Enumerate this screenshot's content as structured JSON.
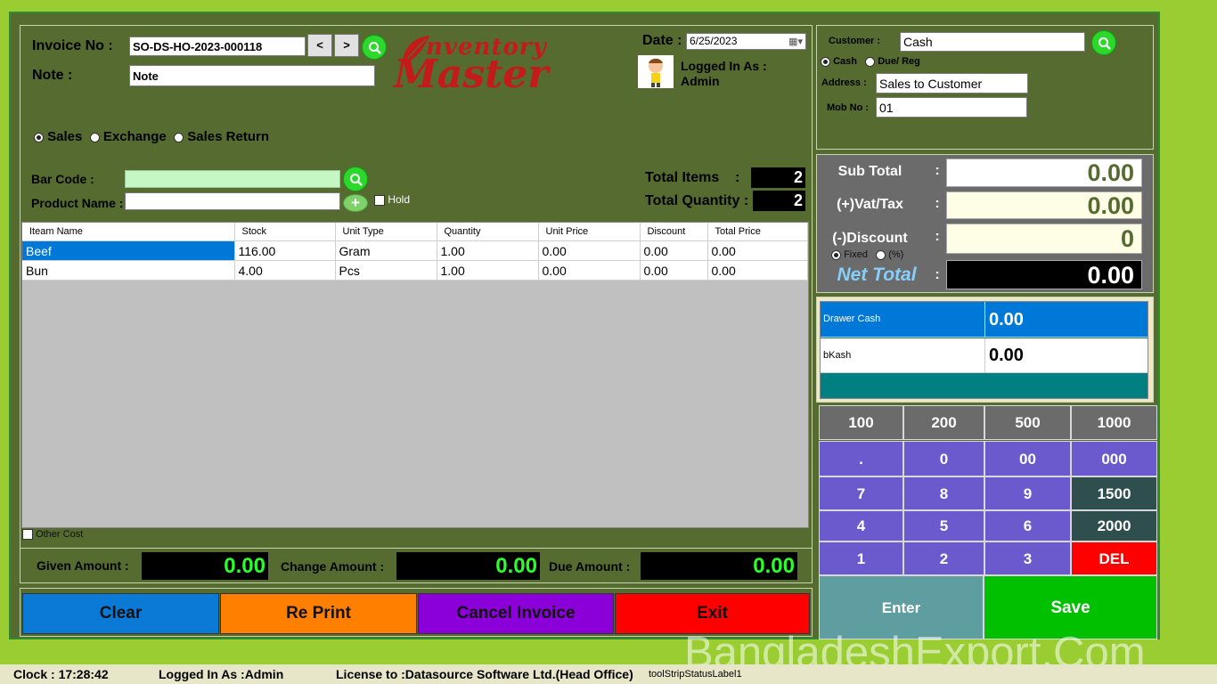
{
  "invoice": {
    "invoice_no_label": "Invoice No :",
    "invoice_no_value": "SO-DS-HO-2023-000118",
    "prev_label": "<",
    "next_label": ">",
    "note_label": "Note :",
    "note_value": "Note"
  },
  "logo": {
    "line1": "nventory",
    "line2": "Master"
  },
  "date": {
    "label": "Date :",
    "value": "6/25/2023"
  },
  "login": {
    "line1": "Logged In As :",
    "line2": "Admin"
  },
  "customer": {
    "label": "Customer :",
    "value": "Cash",
    "radio_cash": "Cash",
    "radio_due": "Due/ Reg",
    "address_label": "Address :",
    "address_value": "Sales to Customer",
    "mob_label": "Mob No :",
    "mob_value": "01"
  },
  "mode": {
    "sales": "Sales",
    "exchange": "Exchange",
    "sales_return": "Sales Return",
    "selected": "sales"
  },
  "entry": {
    "barcode_label": "Bar Code :",
    "product_label": "Product Name :",
    "hold_label": "Hold",
    "total_items_label": "Total Items    :",
    "total_items_value": "2",
    "total_qty_label": "Total Quantity :",
    "total_qty_value": "2"
  },
  "grid": {
    "columns": [
      "Iteam Name",
      "Stock",
      "Unit Type",
      "Quantity",
      "Unit Price",
      "Discount",
      "Total Price"
    ],
    "rows": [
      [
        "Beef",
        "116.00",
        "Gram",
        "1.00",
        "0.00",
        "0.00",
        "0.00"
      ],
      [
        "Bun",
        "4.00",
        "Pcs",
        "1.00",
        "0.00",
        "0.00",
        "0.00"
      ]
    ]
  },
  "other_cost_label": "Other Cost",
  "amounts": {
    "given_label": "Given Amount :",
    "given_value": "0.00",
    "change_label": "Change Amount :",
    "change_value": "0.00",
    "due_label": "Due Amount :",
    "due_value": "0.00"
  },
  "actions": {
    "clear": "Clear",
    "reprint": "Re Print",
    "cancel": "Cancel Invoice",
    "exit": "Exit"
  },
  "totals": {
    "colon": ":",
    "sub_total_label": "Sub Total",
    "sub_total_value": "0.00",
    "vat_label": "(+)Vat/Tax",
    "vat_value": "0.00",
    "discount_label": "(-)Discount",
    "discount_value": "0",
    "fixed_label": "Fixed",
    "percent_label": "(%)",
    "net_label": "Net Total",
    "net_value": "0.00"
  },
  "payments": [
    {
      "name": "Drawer Cash",
      "value": "0.00"
    },
    {
      "name": "bKash",
      "value": "0.00"
    }
  ],
  "keypad": {
    "quick": [
      "100",
      "200",
      "500",
      "1000"
    ],
    "row1": [
      ".",
      "0",
      "00",
      "000"
    ],
    "row2": [
      "7",
      "8",
      "9",
      "1500"
    ],
    "row3": [
      "4",
      "5",
      "6",
      "2000"
    ],
    "row4": [
      "1",
      "2",
      "3",
      "DEL"
    ],
    "enter": "Enter",
    "save": "Save"
  },
  "status": {
    "clock": "Clock : 17:28:42",
    "logged": "Logged In As :Admin",
    "license": "License to :Datasource Software Ltd.(Head Office)",
    "label1": "toolStripStatusLabel1"
  },
  "watermark": "BangladeshExport.Com",
  "colors": {
    "window_bg": "#556b2f",
    "outer_bg": "#9acd32",
    "clear": "#0a7ad6",
    "reprint": "#ff8000",
    "cancel": "#8b00d8",
    "exit": "#ff0000",
    "keypad_purple": "#6a5acd",
    "keypad_gray": "#6b6b6b",
    "keypad_dark": "#2f4f4f",
    "del": "#ff0000",
    "enter": "#5f9ea0",
    "save": "#00c000"
  }
}
